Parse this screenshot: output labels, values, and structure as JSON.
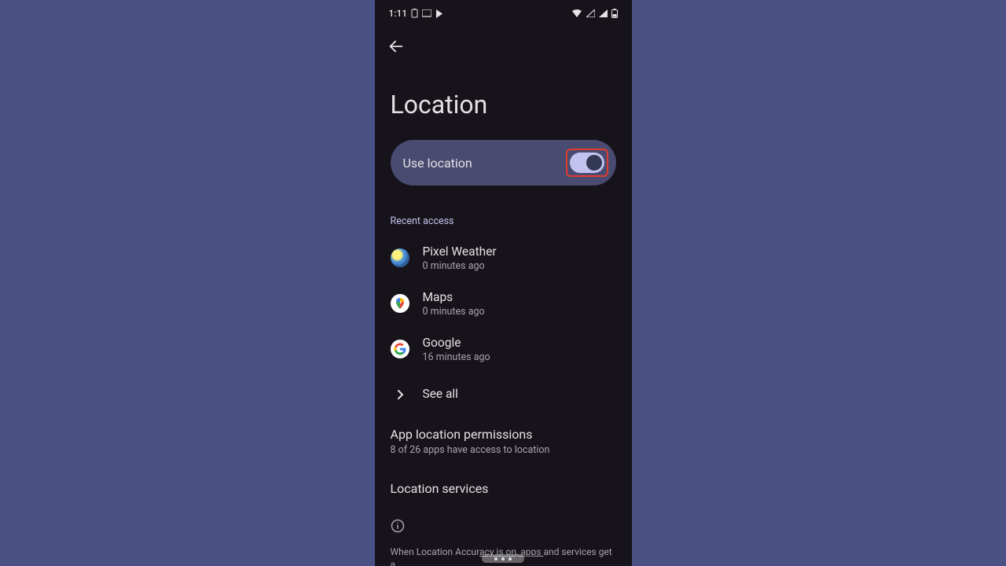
{
  "statusbar": {
    "time": "1:11"
  },
  "page": {
    "title": "Location",
    "use_location_label": "Use location",
    "recent_header": "Recent access",
    "apps": [
      {
        "name": "Pixel Weather",
        "sub": "0 minutes ago"
      },
      {
        "name": "Maps",
        "sub": "0 minutes ago"
      },
      {
        "name": "Google",
        "sub": "16 minutes ago"
      }
    ],
    "see_all": "See all",
    "app_perm_title": "App location permissions",
    "app_perm_sub": "8 of 26 apps have access to location",
    "loc_services": "Location services",
    "disclaimer_a": "When Location Accur",
    "disclaimer_u": "acy is on, apps ",
    "disclaimer_b": "and services get a"
  }
}
